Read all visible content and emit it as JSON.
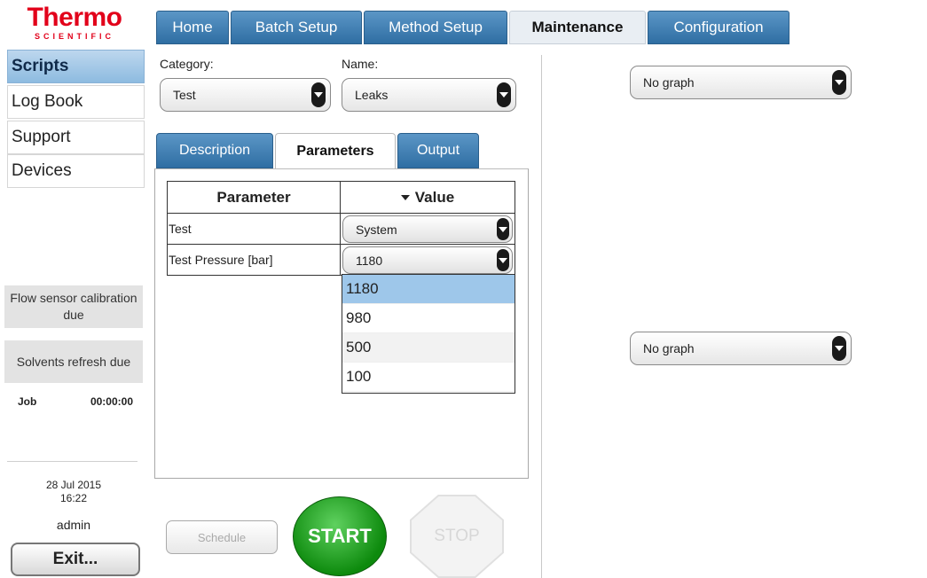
{
  "logo": {
    "brand": "Thermo",
    "sub": "SCIENTIFIC"
  },
  "top_tabs": [
    "Home",
    "Batch Setup",
    "Method Setup",
    "Maintenance",
    "Configuration"
  ],
  "top_tabs_active": "Maintenance",
  "sidebar": {
    "items": [
      "Scripts",
      "Log Book",
      "Support",
      "Devices"
    ],
    "active": "Scripts",
    "status1": "Flow sensor calibration due",
    "status2": "Solvents refresh due",
    "job_label": "Job",
    "job_time": "00:00:00",
    "date": "28 Jul 2015",
    "time": "16:22",
    "user": "admin",
    "exit_label": "Exit..."
  },
  "form": {
    "category_label": "Category:",
    "category_value": "Test",
    "name_label": "Name:",
    "name_value": "Leaks"
  },
  "sub_tabs": [
    "Description",
    "Parameters",
    "Output"
  ],
  "sub_tabs_active": "Parameters",
  "params_table": {
    "headers": [
      "Parameter",
      "Value"
    ],
    "rows": [
      {
        "parameter": "Test",
        "value": "System"
      },
      {
        "parameter": "Test Pressure [bar]",
        "value": "1180"
      }
    ]
  },
  "pressure_options": [
    "1180",
    "980",
    "500",
    "100"
  ],
  "pressure_selected": "1180",
  "buttons": {
    "schedule": "Schedule",
    "start": "START",
    "stop": "STOP"
  },
  "graphs": {
    "top": "No graph",
    "bottom": "No graph"
  },
  "colors": {
    "brand": "#e2001a",
    "tab_blue": "#3a7bb2",
    "start_green": "#0d8a0d",
    "selected_option": "#9ec7ea"
  }
}
